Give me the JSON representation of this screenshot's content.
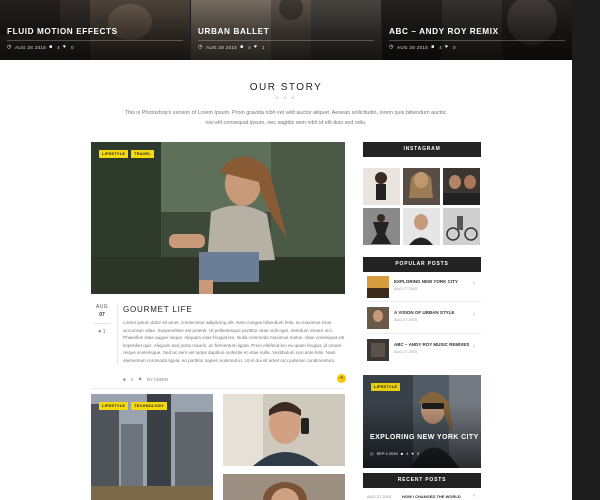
{
  "slider": [
    {
      "title": "FLUID MOTION EFFECTS",
      "date": "AUG 28 2015",
      "comments": "4",
      "likes": "0"
    },
    {
      "title": "URBAN BALLET",
      "date": "AUG 28 2015",
      "comments": "4",
      "likes": "1"
    },
    {
      "title": "ABC – ANDY ROY REMIX",
      "date": "AUG 28 2015",
      "comments": "4",
      "likes": "0"
    }
  ],
  "story": {
    "title": "OUR STORY",
    "dots": "• • •",
    "text": "This is Photoshop's version of Lorem Ipsum. Proin gravida nibh vel velit auctor aliquet. Aenean sollicitudin, lorem quis bibendum auctor, nisi elit consequat ipsum, nec sagittis sem nibh id elit duis sed odio."
  },
  "article": {
    "tags": [
      "LIFESTYLE",
      "TRAVEL"
    ],
    "month": "AUG",
    "day": "07",
    "likes": "1",
    "title": "GOURMET LIFE",
    "text": "Lorem ipsum dolor sit amet, consectetur adipiscing elit. Nam congue bibendum felis, eu maximus risus accumsan vitae. Suspendisse est potenti. Ut pellentesque porttitor vitae velit eget, interdum ornare orci. Phasellus vitae augue neque. Aliquam vitae feugiat leo. Nulla commodo maximus metus, vitae consequat est imperdiet quis. Aliquam sed porta mauris, ac fermentum ligula. Proin eleifend leo eu quam feugiat, id ornare neque scelerisque. Sed ac sem vel turpis dapibus molestie et vitae nulla. Vestibulum non ante felis. Nam elementum commodo ligula, eu porttitor sapien euismod in. Ut et dui sit amet orci pulvinar condimentum.",
    "comments": "4",
    "author": "BY ADMIN"
  },
  "grid_tags": [
    "LIFESTYLE",
    "TECHNOLOGY"
  ],
  "sidebar": {
    "instagram_heading": "INSTAGRAM",
    "popular_heading": "POPULAR POSTS",
    "popular": [
      {
        "title": "EXPLORING NEW YORK CITY",
        "date": "AUG 27 2015"
      },
      {
        "title": "A VISION OF URBAN STYLE",
        "date": "AUG 27 2015"
      },
      {
        "title": "ABC – ANDY ROY MUSIC REMIXES",
        "date": "AUG 27 2015"
      }
    ],
    "feature": {
      "tag": "LIFESTYLE",
      "title": "EXPLORING NEW YORK CITY",
      "date": "SEP 4 2015",
      "comments": "4",
      "likes": "0"
    },
    "recent_heading": "RECENT POSTS",
    "recent": {
      "date": "AUG 27 2015",
      "title": "HOW I CHANGED THE WORLD"
    }
  },
  "colors": {
    "accent": "#f5d90a",
    "dark": "#222222",
    "background": "#1d1d1d"
  }
}
